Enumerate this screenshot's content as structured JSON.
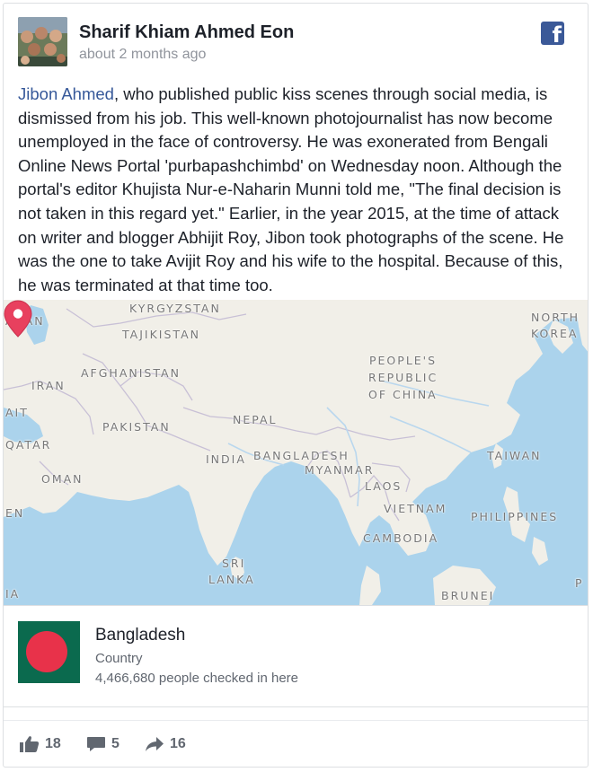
{
  "post": {
    "author": "Sharif Khiam Ahmed Eon",
    "time": "about 2 months ago",
    "text_link": "Jibon Ahmed",
    "text_body": ", who published public kiss scenes through social media, is dismissed from his job. This well-known photojournalist has now become unemployed in the face of controversy. He was exonerated from Bengali Online News Portal 'purbapashchimbd' on Wednesday noon. Although the portal's editor Khujista Nur-e-Naharin Munni told me, \"The final decision is not taken in this regard yet.\" Earlier, in the year 2015, at the time of attack on writer and blogger Abhijit Roy, Jibon took photographs of the scene. He was the one to take Avijit Roy and his wife to the hospital. Because of this, he was terminated at that time too."
  },
  "map": {
    "labels": {
      "kyrgyzstan": "KYRGYZSTAN",
      "aijan": "AIJAN",
      "tajikistan": "TAJIKISTAN",
      "north_korea_1": "NORTH",
      "north_korea_2": "KOREA",
      "peoples_1": "PEOPLE'S",
      "peoples_2": "REPUBLIC",
      "peoples_3": "OF CHINA",
      "afghanistan": "AFGHANISTAN",
      "iran": "IRAN",
      "ait": "AIT",
      "nepal": "NEPAL",
      "pakistan": "PAKISTAN",
      "qatar": "QATAR",
      "india": "INDIA",
      "bangladesh": "BANGLADESH",
      "taiwan": "TAIWAN",
      "myanmar": "MYANMAR",
      "oman": "OMAN",
      "laos": "LAOS",
      "vietnam": "VIETNAM",
      "en": "EN",
      "philippines": "PHILIPPINES",
      "cambodia": "CAMBODIA",
      "sri_1": "SRI",
      "sri_2": "LANKA",
      "ia": "IA",
      "brunei": "BRUNEI",
      "p": "P"
    },
    "marker_icon": "map-pin-icon"
  },
  "place": {
    "name": "Bangladesh",
    "category": "Country",
    "checkins": "4,466,680 people checked in here",
    "flag_colors": {
      "field": "#0b6a4e",
      "disc": "#e8324a"
    }
  },
  "actions": {
    "likes": "18",
    "comments": "5",
    "shares": "16"
  },
  "colors": {
    "link": "#365899",
    "facebook": "#3b5998",
    "pin": "#e8405e",
    "water": "#abd3ec",
    "land": "#f1efe8"
  }
}
